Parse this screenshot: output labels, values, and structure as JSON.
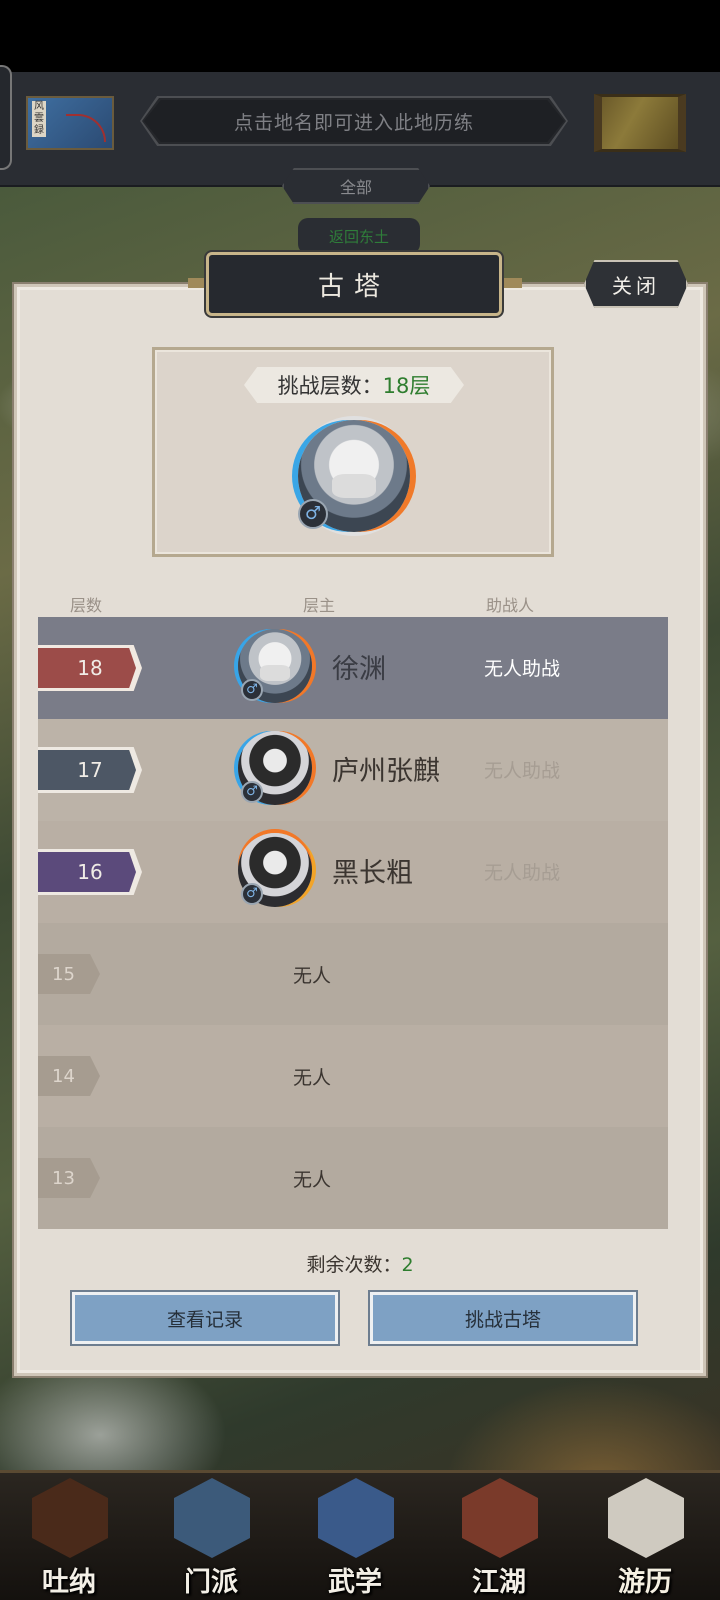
{
  "topbar": {
    "scroll_label": "风雲録",
    "hint": "点击地名即可进入此地历练",
    "filter_label": "全部",
    "back_label": "返回东土"
  },
  "dialog": {
    "title": "古塔",
    "close_label": "关闭",
    "boss": {
      "floor_label": "挑战层数：",
      "floor_value": "18层",
      "gender_symbol": "♂"
    },
    "columns": {
      "floor": "层数",
      "owner": "层主",
      "helper": "助战人"
    },
    "rows": [
      {
        "floor": "18",
        "owner": "徐渊",
        "helper": "无人助战",
        "gender": "♂"
      },
      {
        "floor": "17",
        "owner": "庐州张麒",
        "helper": "无人助战",
        "gender": "♂"
      },
      {
        "floor": "16",
        "owner": "黑长粗",
        "helper": "无人助战",
        "gender": "♂"
      },
      {
        "floor": "15",
        "owner": "无人"
      },
      {
        "floor": "14",
        "owner": "无人"
      },
      {
        "floor": "13",
        "owner": "无人"
      }
    ],
    "remaining_label": "剩余次数：",
    "remaining_value": "2",
    "buttons": {
      "records": "查看记录",
      "challenge": "挑战古塔"
    }
  },
  "bottom_nav": [
    {
      "label": "吐纳",
      "icon": "meditation-icon"
    },
    {
      "label": "门派",
      "icon": "sect-icon"
    },
    {
      "label": "武学",
      "icon": "martial-arts-book-icon"
    },
    {
      "label": "江湖",
      "icon": "jianghu-hat-icon"
    },
    {
      "label": "游历",
      "icon": "horse-icon",
      "active": true
    }
  ],
  "colors": {
    "accent_green": "#2e7d2e",
    "selected_row": "#7a7c88",
    "button_blue": "#7ea1c4"
  }
}
